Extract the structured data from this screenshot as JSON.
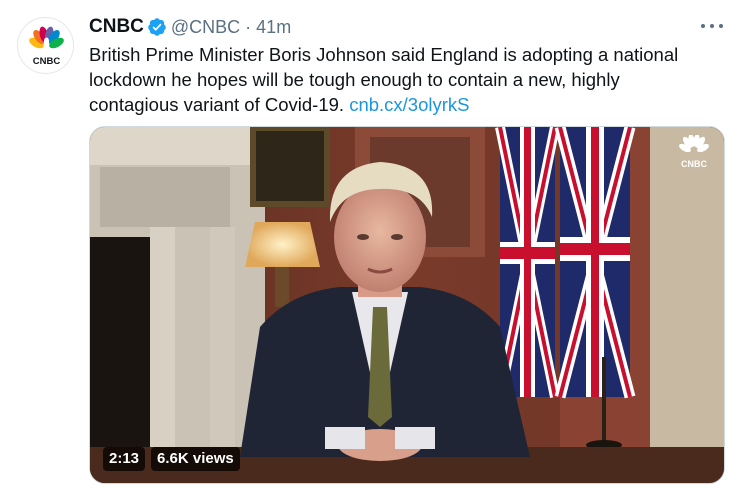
{
  "tweet": {
    "name": "CNBC",
    "handle": "@CNBC",
    "separator": "·",
    "time": "41m",
    "text": "British Prime Minister Boris Johnson said England is adopting a national lockdown he hopes will be tough enough to contain a new, highly contagious variant of Covid-19. ",
    "link": "cnb.cx/3olyrkS",
    "avatar_label": "CNBC"
  },
  "media": {
    "duration": "2:13",
    "views": "6.6K views",
    "watermark_label": "CNBC"
  },
  "icons": {
    "verified": "verified-badge-icon",
    "more": "more-options-icon",
    "logo": "nbc-peacock-icon"
  },
  "colors": {
    "link": "#1b95e0",
    "verified": "#1da1f2",
    "secondary_text": "#5b7083"
  }
}
